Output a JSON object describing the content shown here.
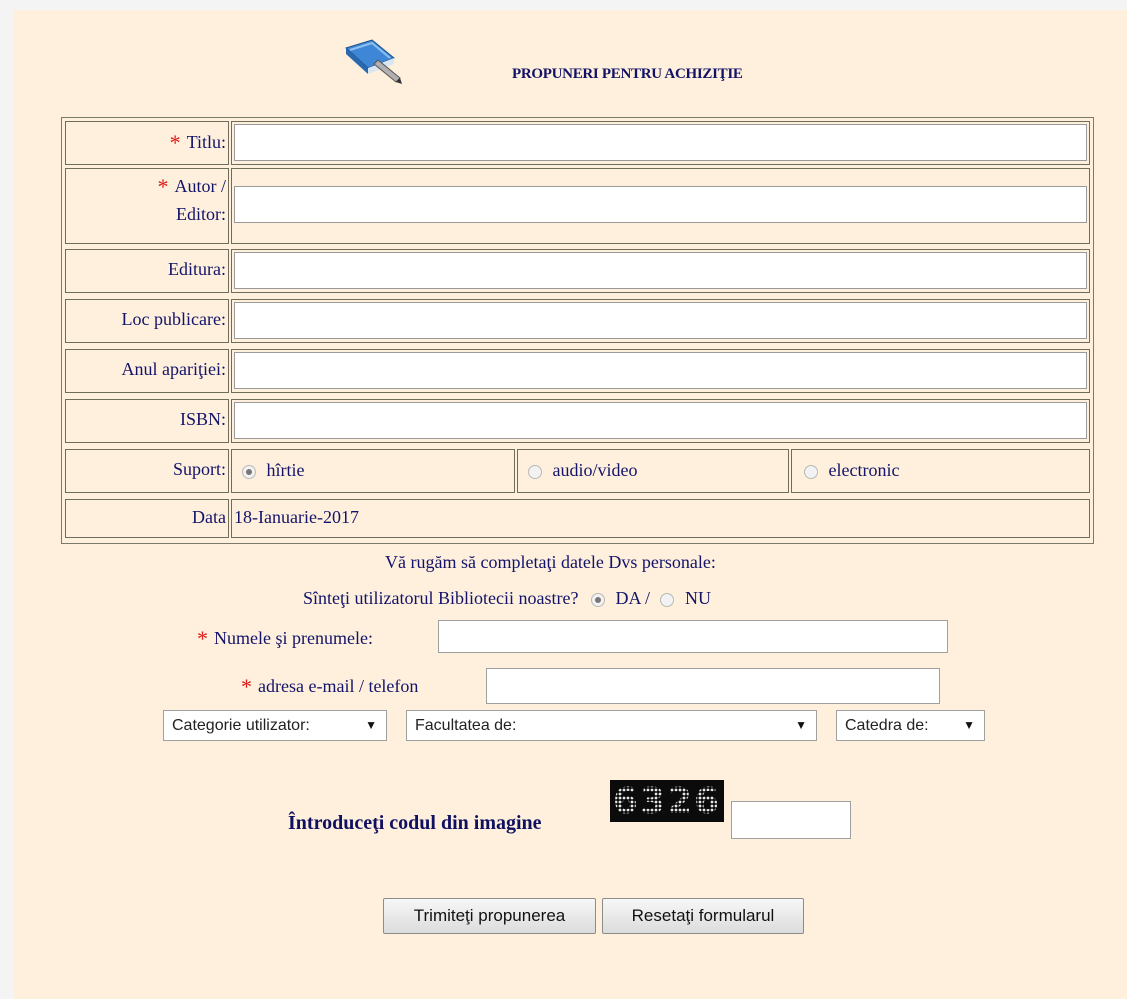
{
  "header": {
    "title": "PROPUNERI PENTRU ACHIZIŢIE",
    "logo_icon": "book-icon"
  },
  "form": {
    "fields": [
      {
        "label": "Titlu:",
        "required": true,
        "value": ""
      },
      {
        "label_line1": "Autor /",
        "label_line2": "Editor:",
        "required": true,
        "value": ""
      },
      {
        "label": "Editura:",
        "required": false,
        "value": ""
      },
      {
        "label": "Loc publicare:",
        "required": false,
        "value": ""
      },
      {
        "label": "Anul apariţiei:",
        "required": false,
        "value": ""
      },
      {
        "label": "ISBN:",
        "required": false,
        "value": ""
      }
    ],
    "support": {
      "label": "Suport:",
      "options": [
        {
          "label": "hîrtie",
          "checked": true
        },
        {
          "label": "audio/video",
          "checked": false
        },
        {
          "label": "electronic",
          "checked": false
        }
      ]
    },
    "date": {
      "label": "Data",
      "value": "18-Ianuarie-2017"
    },
    "required_marker": "*"
  },
  "personal": {
    "intro": "Vă rugăm să completaţi datele Dvs personale:",
    "user_question": "Sînteţi utilizatorul Bibliotecii noastre?",
    "user_yes": "DA /",
    "user_no": "NU",
    "user_yes_checked": true,
    "name_label": "Numele şi prenumele:",
    "name_value": "",
    "contact_label": "adresa e-mail / telefon",
    "contact_value": ""
  },
  "selects": {
    "category": "Categorie utilizator:",
    "faculty": "Facultatea de:",
    "department": "Catedra de:"
  },
  "captcha": {
    "label": "Întroduceţi codul din imagine",
    "code": "6326",
    "value": ""
  },
  "buttons": {
    "submit": "Trimiteţi propunerea",
    "reset": "Resetaţi formularul"
  }
}
